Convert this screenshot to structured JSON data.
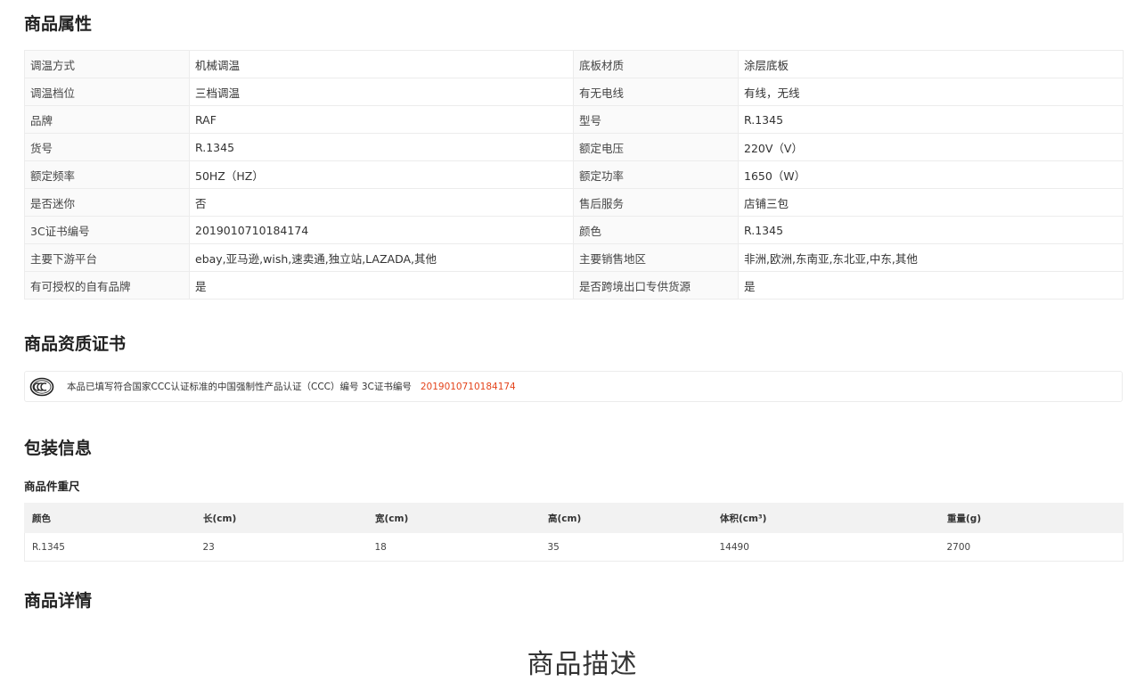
{
  "sections": {
    "attributes_title": "商品属性",
    "certificate_title": "商品资质证书",
    "packaging_title": "包装信息",
    "details_title": "商品详情"
  },
  "attributes": [
    {
      "k1": "调温方式",
      "v1": "机械调温",
      "k2": "底板材质",
      "v2": "涂层底板"
    },
    {
      "k1": "调温档位",
      "v1": "三档调温",
      "k2": "有无电线",
      "v2": "有线，无线"
    },
    {
      "k1": "品牌",
      "v1": "RAF",
      "k2": "型号",
      "v2": "R.1345"
    },
    {
      "k1": "货号",
      "v1": "R.1345",
      "k2": "额定电压",
      "v2": "220V（V）"
    },
    {
      "k1": "额定频率",
      "v1": "50HZ（HZ）",
      "k2": "额定功率",
      "v2": "1650（W）"
    },
    {
      "k1": "是否迷你",
      "v1": "否",
      "k2": "售后服务",
      "v2": "店铺三包"
    },
    {
      "k1": "3C证书编号",
      "v1": "2019010710184174",
      "k2": "颜色",
      "v2": "R.1345"
    },
    {
      "k1": "主要下游平台",
      "v1": "ebay,亚马逊,wish,速卖通,独立站,LAZADA,其他",
      "k2": "主要销售地区",
      "v2": "非洲,欧洲,东南亚,东北亚,中东,其他"
    },
    {
      "k1": "有可授权的自有品牌",
      "v1": "是",
      "k2": "是否跨境出口专供货源",
      "v2": "是"
    }
  ],
  "certificate": {
    "logo_icon": "ccc-certification-icon",
    "text": "本品已填写符合国家CCC认证标准的中国强制性产品认证（CCC）编号 3C证书编号",
    "number": "2019010710184174",
    "number_color": "#e4441c"
  },
  "packaging": {
    "subtitle": "商品件重尺",
    "headers": {
      "color": "颜色",
      "length": "长(cm)",
      "width": "宽(cm)",
      "height": "高(cm)",
      "volume": "体积(cm³)",
      "weight": "重量(g)"
    },
    "row": {
      "color": "R.1345",
      "length": "23",
      "width": "18",
      "height": "35",
      "volume": "14490",
      "weight": "2700"
    }
  },
  "details": {
    "description_heading": "商品描述"
  }
}
